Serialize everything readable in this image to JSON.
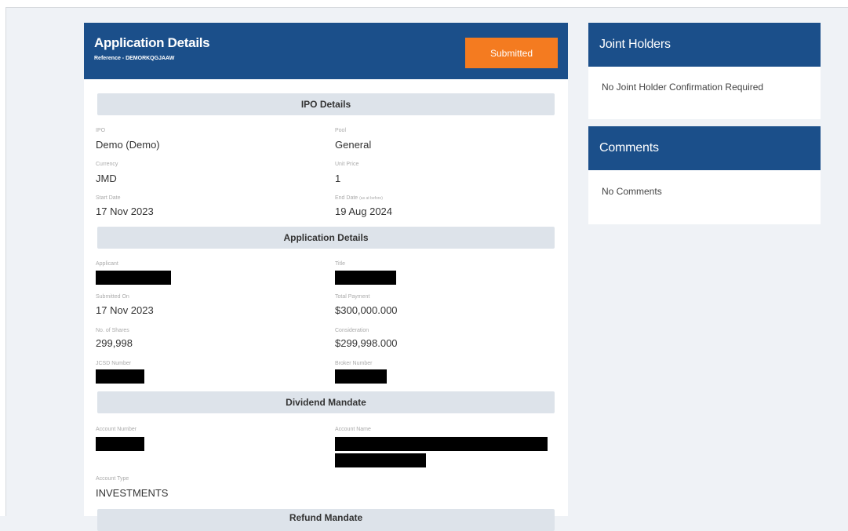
{
  "application": {
    "title": "Application Details",
    "reference": "Reference - DEMORKQGJAAW",
    "status_button": "Submitted",
    "accent_color": "#1b4f8a",
    "status_color": "#f47b20"
  },
  "ipo_details": {
    "heading": "IPO Details",
    "ipo": {
      "label": "IPO",
      "value": "Demo (Demo)"
    },
    "pool": {
      "label": "Pool",
      "value": "General"
    },
    "currency": {
      "label": "Currency",
      "value": "JMD"
    },
    "unit_price": {
      "label": "Unit Price",
      "value": "1"
    },
    "start_date": {
      "label": "Start Date",
      "value": "17 Nov 2023"
    },
    "end_date": {
      "label": "End Date",
      "label_note": "(as at before)",
      "value": "19 Aug 2024"
    }
  },
  "application_details": {
    "heading": "Application Details",
    "applicant": {
      "label": "Applicant"
    },
    "title_field": {
      "label": "Title"
    },
    "submitted_on": {
      "label": "Submitted On",
      "value": "17 Nov 2023"
    },
    "total_payment": {
      "label": "Total Payment",
      "value": "$300,000.000"
    },
    "no_of_shares": {
      "label": "No. of Shares",
      "value": "299,998"
    },
    "consideration": {
      "label": "Consideration",
      "value": "$299,998.000"
    },
    "jcsd_number": {
      "label": "JCSD Number"
    },
    "broker_number": {
      "label": "Broker Number"
    }
  },
  "dividend_mandate": {
    "heading": "Dividend Mandate",
    "account_number": {
      "label": "Account Number"
    },
    "account_name": {
      "label": "Account Name"
    },
    "account_type": {
      "label": "Account Type",
      "value": "INVESTMENTS"
    }
  },
  "refund_mandate": {
    "heading": "Refund Mandate"
  },
  "joint_holders": {
    "title": "Joint Holders",
    "message": "No Joint Holder Confirmation Required"
  },
  "comments": {
    "title": "Comments",
    "message": "No Comments"
  }
}
